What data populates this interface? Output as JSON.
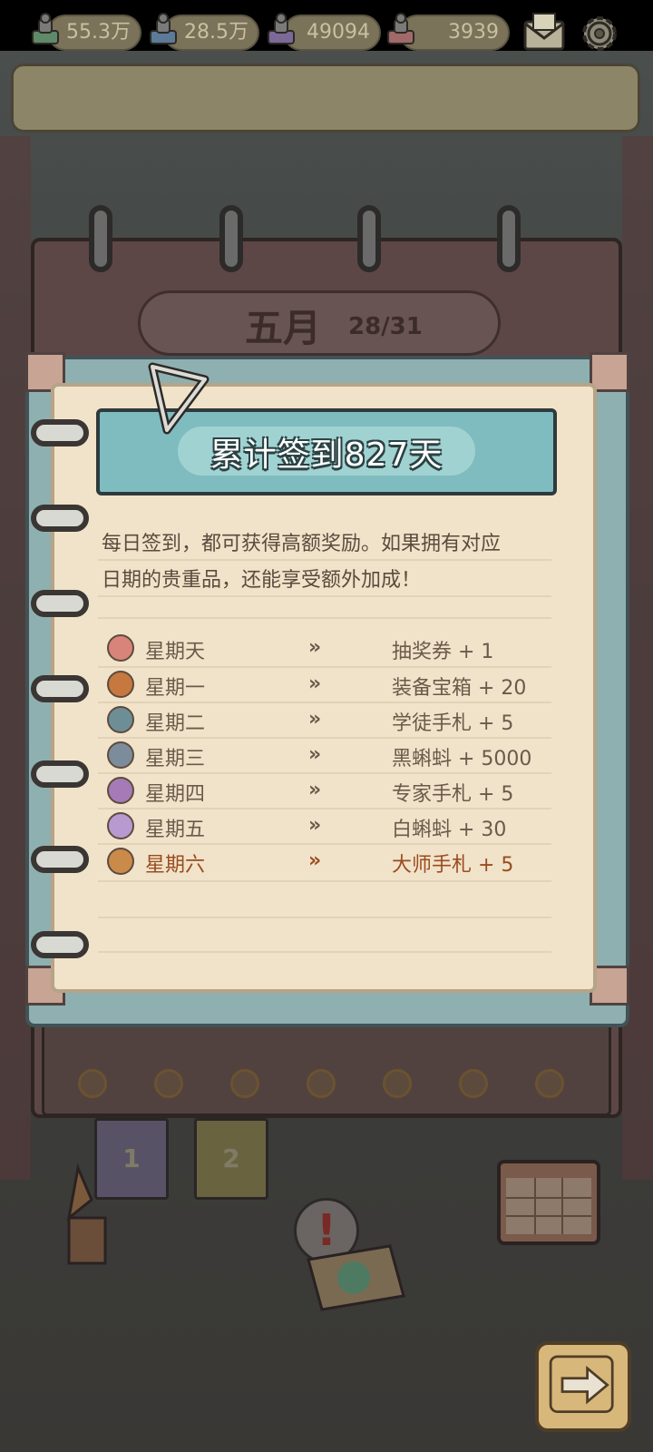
{
  "resources": [
    {
      "icon": "green-stamp-icon",
      "value": "55.3万"
    },
    {
      "icon": "blue-stamp-icon",
      "value": "28.5万"
    },
    {
      "icon": "purple-stamp-icon",
      "value": "49094"
    },
    {
      "icon": "red-stamp-icon",
      "value": "3939"
    }
  ],
  "calendar": {
    "month": "五月",
    "progress": "28/31"
  },
  "signin": {
    "banner_title": "累计签到827天",
    "description_line1": "每日签到，都可获得高额奖励。如果拥有对应",
    "description_line2": "日期的贵重品，还能享受额外加成！",
    "arrow_glyph": "»",
    "rows": [
      {
        "day": "星期天",
        "reward": "抽奖券 + 1",
        "icon": "lottery-ticket-icon",
        "color": "#d9847a"
      },
      {
        "day": "星期一",
        "reward": "装备宝箱 + 20",
        "icon": "equipment-chest-icon",
        "color": "#c7783e"
      },
      {
        "day": "星期二",
        "reward": "学徒手札 + 5",
        "icon": "apprentice-notes-icon",
        "color": "#6e8e96"
      },
      {
        "day": "星期三",
        "reward": "黑蝌蚪 + 5000",
        "icon": "black-tadpole-icon",
        "color": "#7d8c9a"
      },
      {
        "day": "星期四",
        "reward": "专家手札 + 5",
        "icon": "expert-notes-icon",
        "color": "#a67ab6"
      },
      {
        "day": "星期五",
        "reward": "白蝌蚪 + 30",
        "icon": "white-tadpole-icon",
        "color": "#b89ad0"
      },
      {
        "day": "星期六",
        "reward": "大师手札 + 5",
        "icon": "master-notes-icon",
        "color": "#c98a4a",
        "highlight": true
      }
    ]
  },
  "scene": {
    "ticket1": "1",
    "ticket2": "2",
    "alert": "!"
  },
  "colors": {
    "panel_frame": "#8fb0b0",
    "paper": "#f1e3c9",
    "banner": "#7fbcbf",
    "highlight_text": "#9a4c20"
  }
}
